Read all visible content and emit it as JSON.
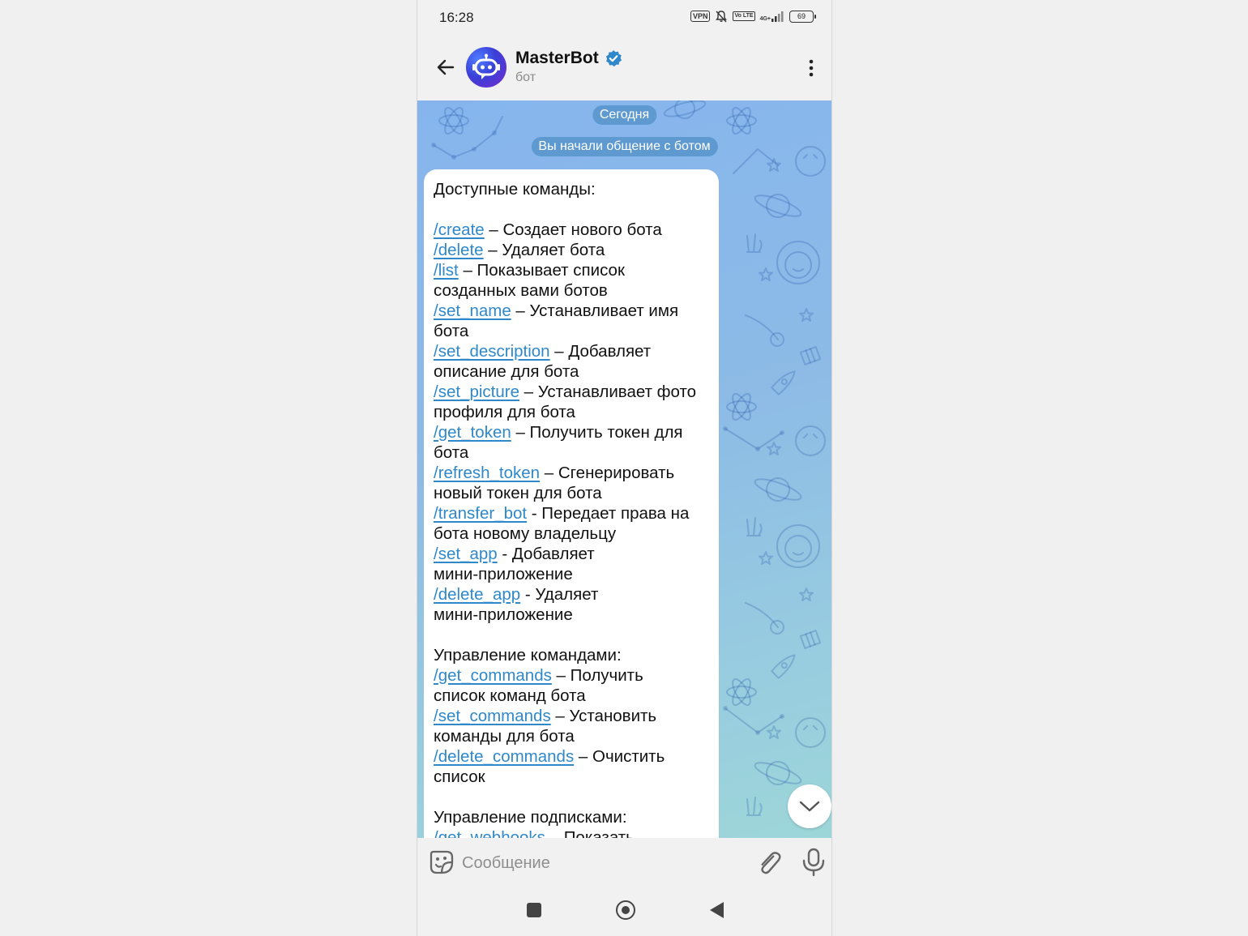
{
  "status_bar": {
    "time": "16:28",
    "vpn": "VPN",
    "network": "4G+",
    "volte": "Vo LTE",
    "battery": "69"
  },
  "header": {
    "title": "MasterBot",
    "subtitle": "бот",
    "verified": true,
    "accent": "#2f88c9"
  },
  "chat": {
    "date_pill": "Сегодня",
    "service_message": "Вы начали общение с ботом",
    "message_lines": [
      {
        "text": "Доступные команды:"
      },
      {
        "text": ""
      },
      {
        "cmd": "/create",
        "text": " – Создает нового бота"
      },
      {
        "cmd": "/delete",
        "text": " – Удаляет бота"
      },
      {
        "cmd": "/list",
        "text": " – Показывает список"
      },
      {
        "text": "созданных вами ботов"
      },
      {
        "cmd": "/set_name",
        "text": " – Устанавливает имя"
      },
      {
        "text": "бота"
      },
      {
        "cmd": "/set_description",
        "text": " – Добавляет"
      },
      {
        "text": "описание для бота"
      },
      {
        "cmd": "/set_picture",
        "text": " – Устанавливает фото"
      },
      {
        "text": "профиля для бота"
      },
      {
        "cmd": "/get_token",
        "text": " – Получить токен для"
      },
      {
        "text": "бота"
      },
      {
        "cmd": "/refresh_token",
        "text": " – Сгенерировать"
      },
      {
        "text": "новый токен для бота"
      },
      {
        "cmd": "/transfer_bot",
        "text": " - Передает права на"
      },
      {
        "text": "бота новому владельцу"
      },
      {
        "cmd": "/set_app",
        "text": " - Добавляет"
      },
      {
        "text": "мини-приложение"
      },
      {
        "cmd": "/delete_app",
        "text": " - Удаляет"
      },
      {
        "text": "мини-приложение"
      },
      {
        "text": ""
      },
      {
        "text": "Управление командами:"
      },
      {
        "cmd": "/get_commands",
        "text": " – Получить"
      },
      {
        "text": "список команд бота"
      },
      {
        "cmd": "/set_commands",
        "text": " – Установить"
      },
      {
        "text": "команды для бота"
      },
      {
        "cmd": "/delete_commands",
        "text": " – Очистить"
      },
      {
        "text": "список"
      },
      {
        "text": ""
      },
      {
        "text": "Управление подписками:"
      },
      {
        "cmd": "/get_webhooks",
        "text": " – Показать"
      }
    ]
  },
  "input": {
    "placeholder": "Сообщение"
  },
  "icons": {
    "back": "arrow-left-icon",
    "more": "more-vert-icon",
    "emoji": "sticker-icon",
    "attach": "paperclip-icon",
    "mic": "microphone-icon",
    "scroll": "chevron-down-icon"
  }
}
